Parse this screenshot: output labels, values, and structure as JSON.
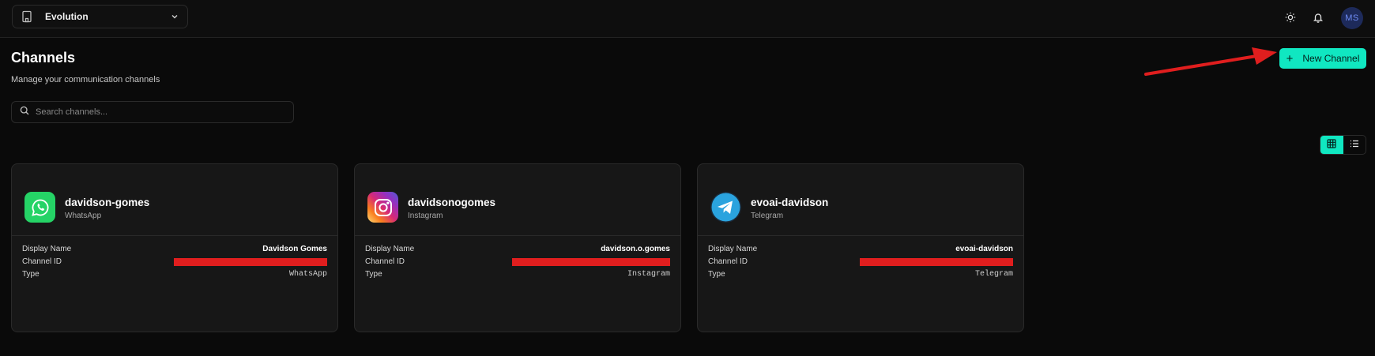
{
  "workspace": {
    "name": "Evolution",
    "icon": "building-icon"
  },
  "topbar": {
    "avatar_initials": "MS"
  },
  "page": {
    "title": "Channels",
    "subtitle": "Manage your communication channels"
  },
  "actions": {
    "new_channel_label": "New Channel"
  },
  "search": {
    "placeholder": "Search channels..."
  },
  "view": {
    "active": "grid"
  },
  "colors": {
    "accent": "#10e7c1",
    "whatsapp": "#25d366",
    "telegram": "#2aa3de",
    "redaction": "#e01e1e"
  },
  "channels": [
    {
      "name": "davidson-gomes",
      "type": "WhatsApp",
      "display_name_label": "Display Name",
      "display_name": "Davidson Gomes",
      "channel_id_label": "Channel ID",
      "type_label": "Type",
      "type_code": "WhatsApp",
      "icon": "whatsapp-icon"
    },
    {
      "name": "davidsonogomes",
      "type": "Instagram",
      "display_name_label": "Display Name",
      "display_name": "davidson.o.gomes",
      "channel_id_label": "Channel ID",
      "type_label": "Type",
      "type_code": "Instagram",
      "icon": "instagram-icon"
    },
    {
      "name": "evoai-davidson",
      "type": "Telegram",
      "display_name_label": "Display Name",
      "display_name": "evoai-davidson",
      "channel_id_label": "Channel ID",
      "type_label": "Type",
      "type_code": "Telegram",
      "icon": "telegram-icon"
    }
  ]
}
